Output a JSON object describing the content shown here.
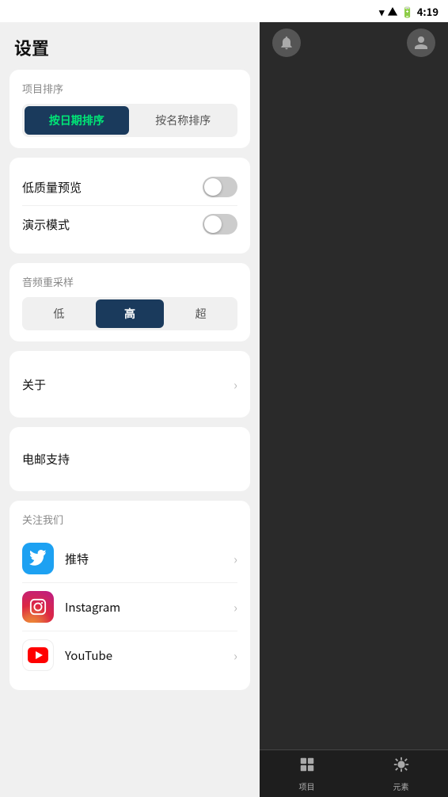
{
  "statusBar": {
    "time": "4:19"
  },
  "settings": {
    "title": "设置",
    "sortSection": {
      "label": "项目排序",
      "sortByDate": "按日期排序",
      "sortByName": "按名称排序",
      "activeSort": "date"
    },
    "toggleSection": {
      "lowQualityPreview": {
        "label": "低质量预览",
        "on": false
      },
      "presentationMode": {
        "label": "演示模式",
        "on": false
      }
    },
    "audioResampleSection": {
      "label": "音频重采样",
      "options": [
        "低",
        "高",
        "超"
      ],
      "active": "高"
    },
    "about": {
      "label": "关于"
    },
    "emailSupport": {
      "label": "电邮支持"
    },
    "followUs": {
      "label": "关注我们",
      "items": [
        {
          "name": "推特",
          "platform": "twitter"
        },
        {
          "name": "Instagram",
          "platform": "instagram"
        },
        {
          "name": "YouTube",
          "platform": "youtube"
        }
      ]
    }
  },
  "bottomNav": {
    "items": [
      {
        "label": "项目",
        "icon": "📁"
      },
      {
        "label": "元素",
        "icon": "🎭"
      }
    ]
  }
}
